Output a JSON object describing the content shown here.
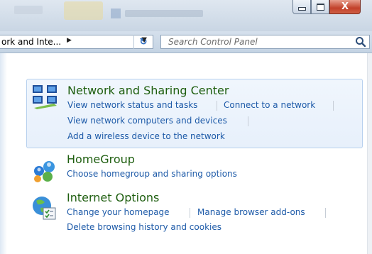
{
  "colors": {
    "title_text": "#1e5e0f",
    "link_text": "#1d5aa8",
    "highlight_bg": "#e7f0fb",
    "highlight_border": "#b7d0ee",
    "close_button": "#c2412a"
  },
  "window": {
    "minimize_icon": "minimize-icon",
    "maximize_icon": "maximize-icon",
    "close_label": "X"
  },
  "addressbar": {
    "breadcrumb": "ork and Inte...",
    "breadcrumb_arrow": "▶",
    "dropdown_arrow": "▼",
    "refresh_glyph": "↻"
  },
  "search": {
    "placeholder": "Search Control Panel",
    "value": ""
  },
  "groups": [
    {
      "title": "Network and Sharing Center",
      "icon": "network-sharing-icon",
      "highlighted": true,
      "links": [
        "View network status and tasks",
        "Connect to a network",
        "View network computers and devices",
        "Add a wireless device to the network"
      ]
    },
    {
      "title": "HomeGroup",
      "icon": "homegroup-icon",
      "highlighted": false,
      "links": [
        "Choose homegroup and sharing options"
      ]
    },
    {
      "title": "Internet Options",
      "icon": "internet-options-icon",
      "highlighted": false,
      "links": [
        "Change your homepage",
        "Manage browser add-ons",
        "Delete browsing history and cookies"
      ]
    }
  ]
}
